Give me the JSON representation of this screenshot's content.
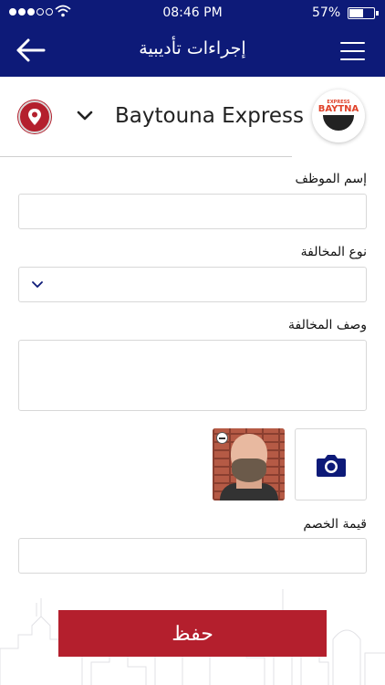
{
  "status_bar": {
    "time": "08:46 PM",
    "battery_text": "57%",
    "battery_level": 0.57,
    "signal_dots_filled": 3,
    "signal_dots_total": 5
  },
  "nav": {
    "title": "إجراءات تأديبية",
    "back_icon": "back-arrow-icon",
    "menu_icon": "hamburger-menu-icon"
  },
  "company": {
    "name": "Baytouna Express",
    "logo_express": "EXPRESS",
    "logo_baytna": "BAYTNA",
    "location_icon": "location-pin-icon",
    "dropdown_icon": "chevron-down-icon"
  },
  "form": {
    "employee_name_label": "إسم الموظف",
    "employee_name_value": "",
    "violation_type_label": "نوع المخالفة",
    "violation_type_value": "",
    "violation_desc_label": "وصف المخالفة",
    "violation_desc_value": "",
    "deduction_label": "قيمة الخصم",
    "deduction_value": ""
  },
  "attachments": {
    "camera_icon": "camera-icon",
    "photo_remove_icon": "minus-circle-icon"
  },
  "save_label": "حفظ",
  "colors": {
    "primary": "#0d1a78",
    "accent": "#b41f2d"
  }
}
